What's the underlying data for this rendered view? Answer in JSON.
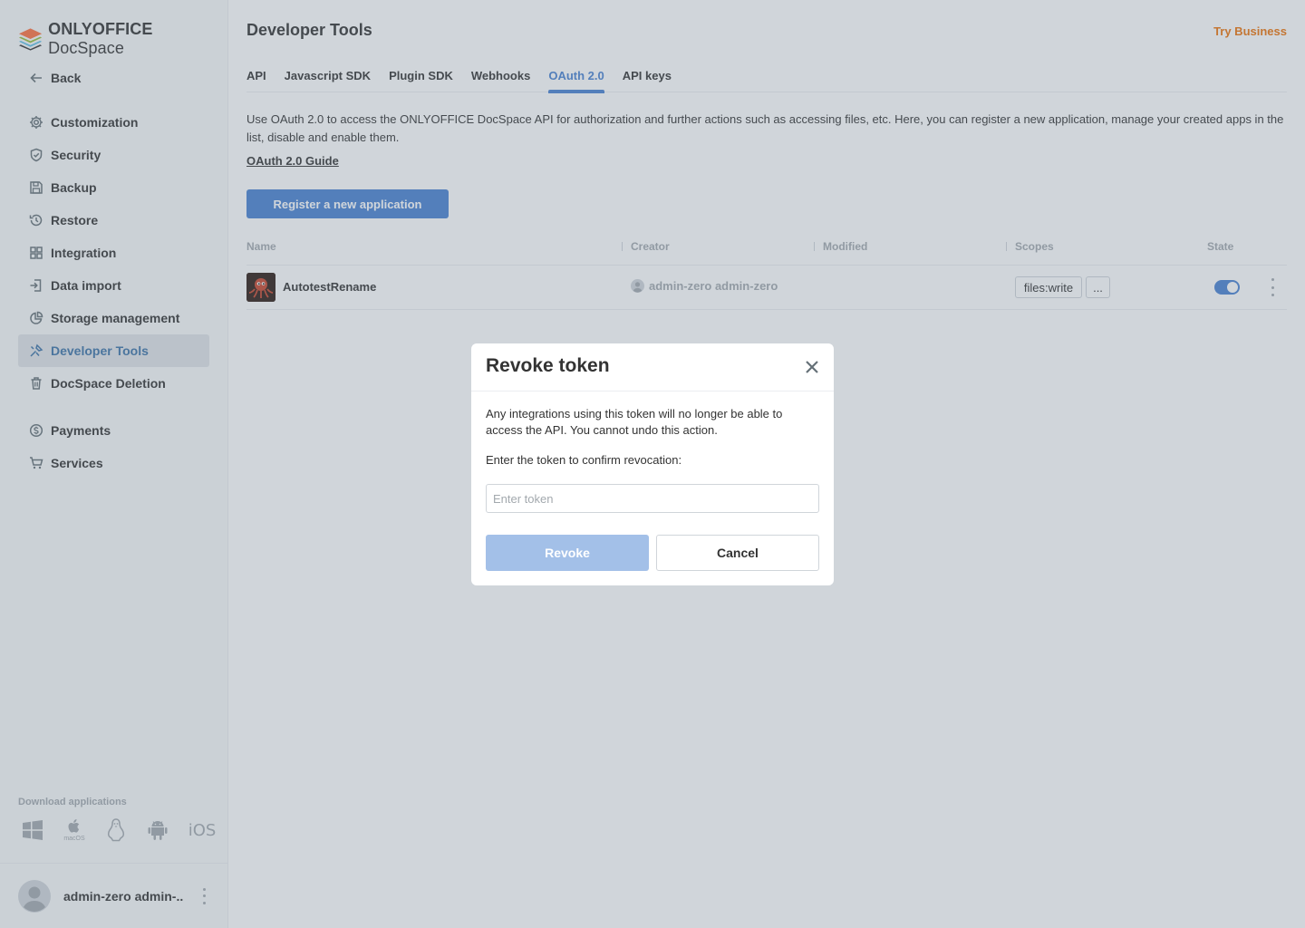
{
  "sidebar": {
    "logo_bold": "ONLYOFFICE",
    "logo_light": " DocSpace",
    "back": "Back",
    "items": [
      {
        "label": "Customization",
        "icon": "gear-icon"
      },
      {
        "label": "Security",
        "icon": "shield-icon"
      },
      {
        "label": "Backup",
        "icon": "save-icon"
      },
      {
        "label": "Restore",
        "icon": "history-icon"
      },
      {
        "label": "Integration",
        "icon": "grid-icon"
      },
      {
        "label": "Data import",
        "icon": "import-icon"
      },
      {
        "label": "Storage management",
        "icon": "pie-chart-icon"
      },
      {
        "label": "Developer Tools",
        "icon": "developer-tools-icon",
        "active": true
      },
      {
        "label": "DocSpace Deletion",
        "icon": "trash-icon"
      },
      {
        "label": "Payments",
        "icon": "dollar-icon"
      },
      {
        "label": "Services",
        "icon": "cart-icon"
      }
    ],
    "download_label": "Download applications",
    "apps": {
      "windows": "windows-icon",
      "macos": "macOS",
      "linux": "linux-icon",
      "android": "android-icon",
      "ios": "iOS"
    },
    "user_name": "admin-zero admin-..."
  },
  "header": {
    "title": "Developer Tools",
    "try_business": "Try Business"
  },
  "tabs": [
    {
      "label": "API"
    },
    {
      "label": "Javascript SDK"
    },
    {
      "label": "Plugin SDK"
    },
    {
      "label": "Webhooks"
    },
    {
      "label": "OAuth 2.0",
      "active": true
    },
    {
      "label": "API keys"
    }
  ],
  "oauth": {
    "description": "Use OAuth 2.0 to access the ONLYOFFICE DocSpace API for authorization and further actions such as accessing files, etc. Here, you can register a new application, manage your created apps in the list, disable and enable them.",
    "guide_link": "OAuth 2.0 Guide",
    "register_button": "Register a new application",
    "columns": {
      "name": "Name",
      "creator": "Creator",
      "modified": "Modified",
      "scopes": "Scopes",
      "state": "State"
    },
    "rows": [
      {
        "name": "AutotestRename",
        "creator": "admin-zero admin-zero",
        "modified": "",
        "scopes": [
          "files:write"
        ],
        "more_scopes": "...",
        "enabled": true
      }
    ]
  },
  "modal": {
    "title": "Revoke token",
    "text": "Any integrations using this token will no longer be able to access the API. You cannot undo this action.",
    "label": "Enter the token to confirm revocation:",
    "input_placeholder": "Enter token",
    "input_value": "",
    "revoke_button": "Revoke",
    "cancel_button": "Cancel"
  },
  "colors": {
    "accent": "#4781d1",
    "active_tab": "#4781d1",
    "try_business": "#ed7309",
    "disabled_button": "#a3c0e8"
  }
}
